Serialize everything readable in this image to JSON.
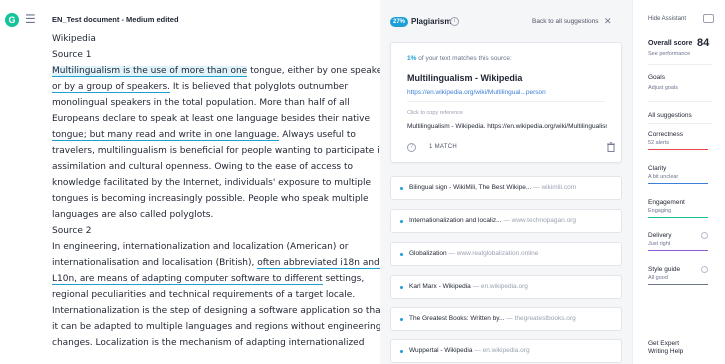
{
  "topbar": {
    "logo_letter": "G",
    "menu_glyph": "☰",
    "doc_title": "EN_Test document - Medium edited"
  },
  "doc": {
    "lines": [
      {
        "text": "Wikipedia"
      },
      {
        "text": "Source 1"
      },
      {
        "hl": "Multilingualism is the use of more than one",
        "text": " tongue, either by one speaker"
      },
      {
        "ul": "or by a group of speakers.",
        "text": " It is believed that polyglots outnumber"
      },
      {
        "text": "monolingual speakers in the total population. More than half of all"
      },
      {
        "text": "Europeans declare to speak at least one language besides their native"
      },
      {
        "ul": "tongue; but many read and write in one language.",
        "text": " Always useful to"
      },
      {
        "text": "travelers, multilingualism is beneficial for people wanting to participate in"
      },
      {
        "text": "assimilation and cultural openness. Owing to the ease of access to"
      },
      {
        "text": "knowledge facilitated by the Internet, individuals' exposure to multiple"
      },
      {
        "text": "tongues is becoming increasingly possible. People who speak multiple"
      },
      {
        "text": "languages are also called polyglots."
      },
      {
        "text": "Source 2"
      },
      {
        "text": "In engineering, internationalization and localization (American) or"
      },
      {
        "pre": "internationalisation and localisation (British), ",
        "ul": "often abbreviated i18n and"
      },
      {
        "ul": "L10n, are means of adapting computer software to different",
        "text": " settings,"
      },
      {
        "text": "regional peculiarities and technical requirements of a target locale."
      },
      {
        "text": "Internationalization is the step of designing a software application so that"
      },
      {
        "text": "it can be adapted to multiple languages and regions without engineering"
      },
      {
        "text": "changes. Localization is the mechanism of adapting internationalized"
      }
    ]
  },
  "plagiarism": {
    "percent_badge": "27%",
    "title": "Plagiarism",
    "info_glyph": "i",
    "back_link": "Back to all suggestions",
    "close_glyph": "✕",
    "card": {
      "match_pct": "1%",
      "match_text": " of your text matches this source:",
      "source_title": "Multilingualism - Wikipedia",
      "source_url": "https://en.wikipedia.org/wiki/Multilingual...person",
      "copy_hint": "Click to copy reference",
      "reference": "Multilingualism - Wikipedia. https://en.wikipedia.org/wiki/Multilingualism",
      "question_glyph": "?",
      "match_count": "1 MATCH"
    },
    "sources": [
      {
        "title": "Bilingual sign - WikiMili, The Best Wikipe...",
        "domain": "wikimili.com"
      },
      {
        "title": "Internationalization and localiz...",
        "domain": "www.technopagan.org"
      },
      {
        "title": "Globalization",
        "domain": "www.realglobalization.online"
      },
      {
        "title": "Karl Marx - Wikipedia",
        "domain": "en.wikipedia.org"
      },
      {
        "title": "The Greatest Books: Written by...",
        "domain": "thegreatestbooks.org"
      },
      {
        "title": "Wuppertal - Wikipedia",
        "domain": "en.wikipedia.org"
      }
    ],
    "separator": " — "
  },
  "sidebar": {
    "hide_assistant": "Hide Assistant",
    "overall_label": "Overall score",
    "overall_score": "84",
    "see_performance": "See performance",
    "goals": "Goals",
    "adjust_goals": "Adjust goals",
    "all_suggestions": "All suggestions",
    "categories": [
      {
        "name": "Correctness",
        "sub": "52 alerts",
        "color": "#e5474f"
      },
      {
        "name": "Clarity",
        "sub": "A bit unclear",
        "color": "#3c7fd6"
      },
      {
        "name": "Engagement",
        "sub": "Engaging",
        "color": "#15c39a"
      },
      {
        "name": "Delivery",
        "sub": "Just right",
        "color": "#8f5bd6"
      },
      {
        "name": "Style guide",
        "sub": "All good",
        "color": "#6d758d"
      }
    ],
    "get_expert": "Get Expert Writing Help"
  }
}
